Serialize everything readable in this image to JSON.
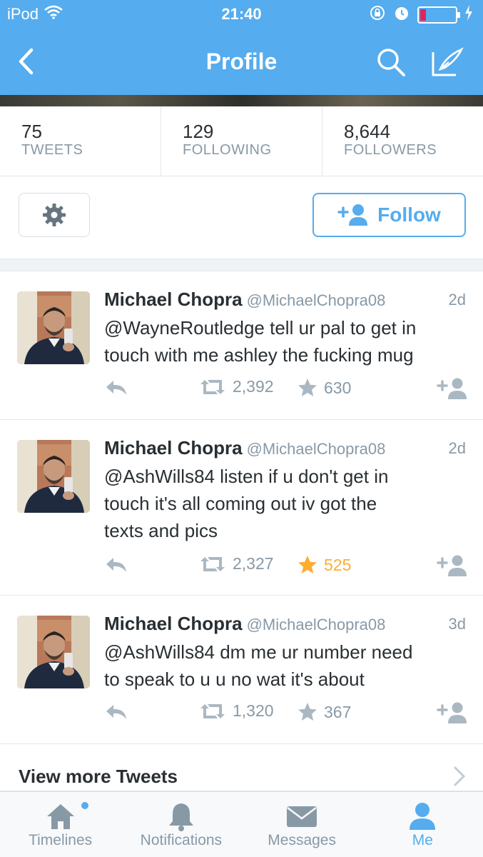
{
  "status_bar": {
    "carrier": "iPod",
    "time": "21:40"
  },
  "nav": {
    "title": "Profile"
  },
  "stats": [
    {
      "value": "75",
      "label": "TWEETS"
    },
    {
      "value": "129",
      "label": "FOLLOWING"
    },
    {
      "value": "8,644",
      "label": "FOLLOWERS"
    }
  ],
  "actions": {
    "follow_label": "Follow"
  },
  "tweets": [
    {
      "name": "Michael Chopra",
      "handle": "@MichaelChopra08",
      "time": "2d",
      "lines": [
        "@WayneRoutledge tell ur pal to get in",
        "touch with me ashley the fucking mug"
      ],
      "retweets": "2,392",
      "favorites": "630",
      "favorited": false
    },
    {
      "name": "Michael Chopra",
      "handle": "@MichaelChopra08",
      "time": "2d",
      "lines": [
        "@AshWills84 listen if u don't get in",
        "touch it's all coming out iv got the",
        "texts and pics"
      ],
      "retweets": "2,327",
      "favorites": "525",
      "favorited": true
    },
    {
      "name": "Michael Chopra",
      "handle": "@MichaelChopra08",
      "time": "3d",
      "lines": [
        "@AshWills84 dm me ur number need",
        "to speak to u u no wat it's about"
      ],
      "retweets": "1,320",
      "favorites": "367",
      "favorited": false
    }
  ],
  "view_more": {
    "label": "View more Tweets"
  },
  "tabs": [
    {
      "label": "Timelines",
      "icon": "home-icon"
    },
    {
      "label": "Notifications",
      "icon": "bell-icon"
    },
    {
      "label": "Messages",
      "icon": "envelope-icon"
    },
    {
      "label": "Me",
      "icon": "person-icon"
    }
  ],
  "colors": {
    "brand": "#55acee",
    "favorite": "#ffac33",
    "muted": "#8899a6"
  }
}
